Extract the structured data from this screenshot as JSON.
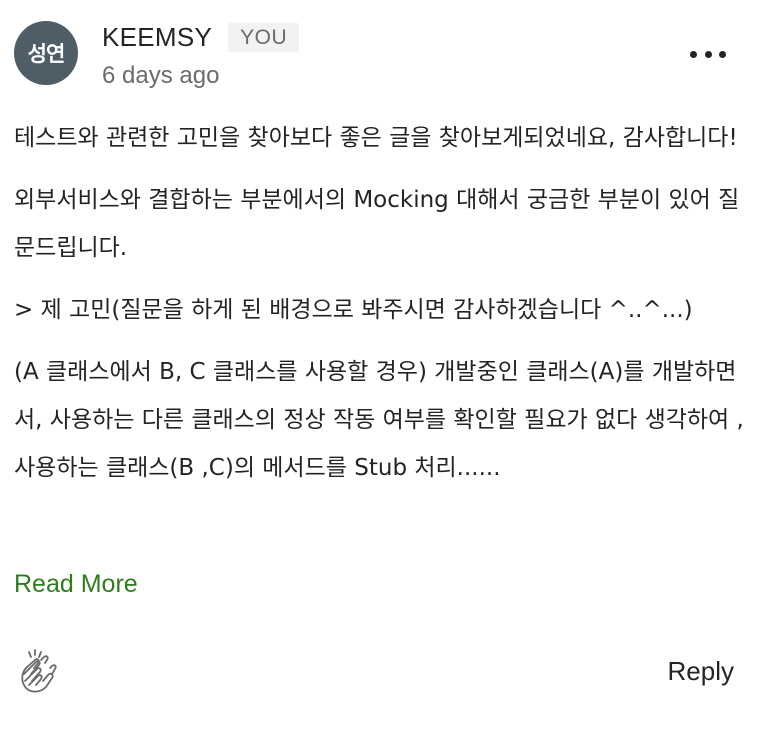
{
  "comment": {
    "avatar_text": "성연",
    "author": "KEEMSY",
    "badge": "YOU",
    "timestamp": "6 days ago",
    "paragraphs": [
      "테스트와 관련한 고민을 찾아보다 좋은 글을 찾아보게되었네요, 감사합니다!",
      "외부서비스와 결합하는 부분에서의 Mocking 대해서 궁금한 부분이 있어 질문드립니다.",
      "> 제 고민(질문을 하게 된 배경으로 봐주시면 감사하겠습니다 ^..^...)",
      "(A 클래스에서 B, C 클래스를 사용할 경우) 개발중인 클래스(A)를 개발하면서, 사용하는 다른 클래스의 정상 작동 여부를 확인할 필요가 없다 생각하여 , 사용하는 클래스(B ,C)의 메서드를 Stub 처리......"
    ],
    "read_more": "Read More",
    "reply": "Reply",
    "icons": {
      "more": "more-horizontal-icon",
      "clap": "clap-icon"
    },
    "colors": {
      "avatar_bg": "#4f5e66",
      "read_more": "#2e7d1e",
      "text": "#242424",
      "muted": "#6b6b6b"
    }
  }
}
